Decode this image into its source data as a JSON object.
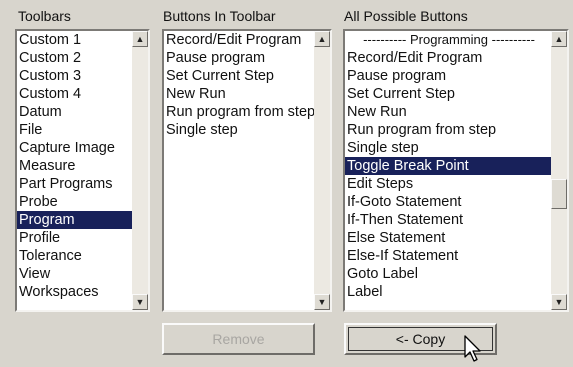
{
  "headers": {
    "toolbars": "Toolbars",
    "buttons_in_toolbar": "Buttons In Toolbar",
    "all_possible_buttons": "All Possible Buttons"
  },
  "toolbars": {
    "items": [
      "Custom 1",
      "Custom 2",
      "Custom 3",
      "Custom 4",
      "Datum",
      "File",
      "Capture Image",
      "Measure",
      "Part Programs",
      "Probe",
      "Program",
      "Profile",
      "Tolerance",
      "View",
      "Workspaces"
    ],
    "selected": "Program"
  },
  "buttons_in_toolbar": {
    "items": [
      "Record/Edit Program",
      "Pause program",
      "Set Current Step",
      "New Run",
      "Run program from step",
      "Single step"
    ]
  },
  "all_possible_buttons": {
    "items": [
      "---------- Programming ----------",
      "Record/Edit Program",
      "Pause program",
      "Set Current Step",
      "New Run",
      "Run program from step",
      "Single step",
      "Toggle Break Point",
      "Edit Steps",
      "If-Goto Statement",
      "If-Then Statement",
      "Else Statement",
      "Else-If Statement",
      "Goto Label",
      "Label"
    ],
    "selected": "Toggle Break Point"
  },
  "buttons": {
    "remove": "Remove",
    "copy": "<- Copy"
  },
  "colors": {
    "selection": "#18215a",
    "background": "#d8d5cd"
  },
  "scrollbar_icons": {
    "up": "▲",
    "down": "▼"
  }
}
